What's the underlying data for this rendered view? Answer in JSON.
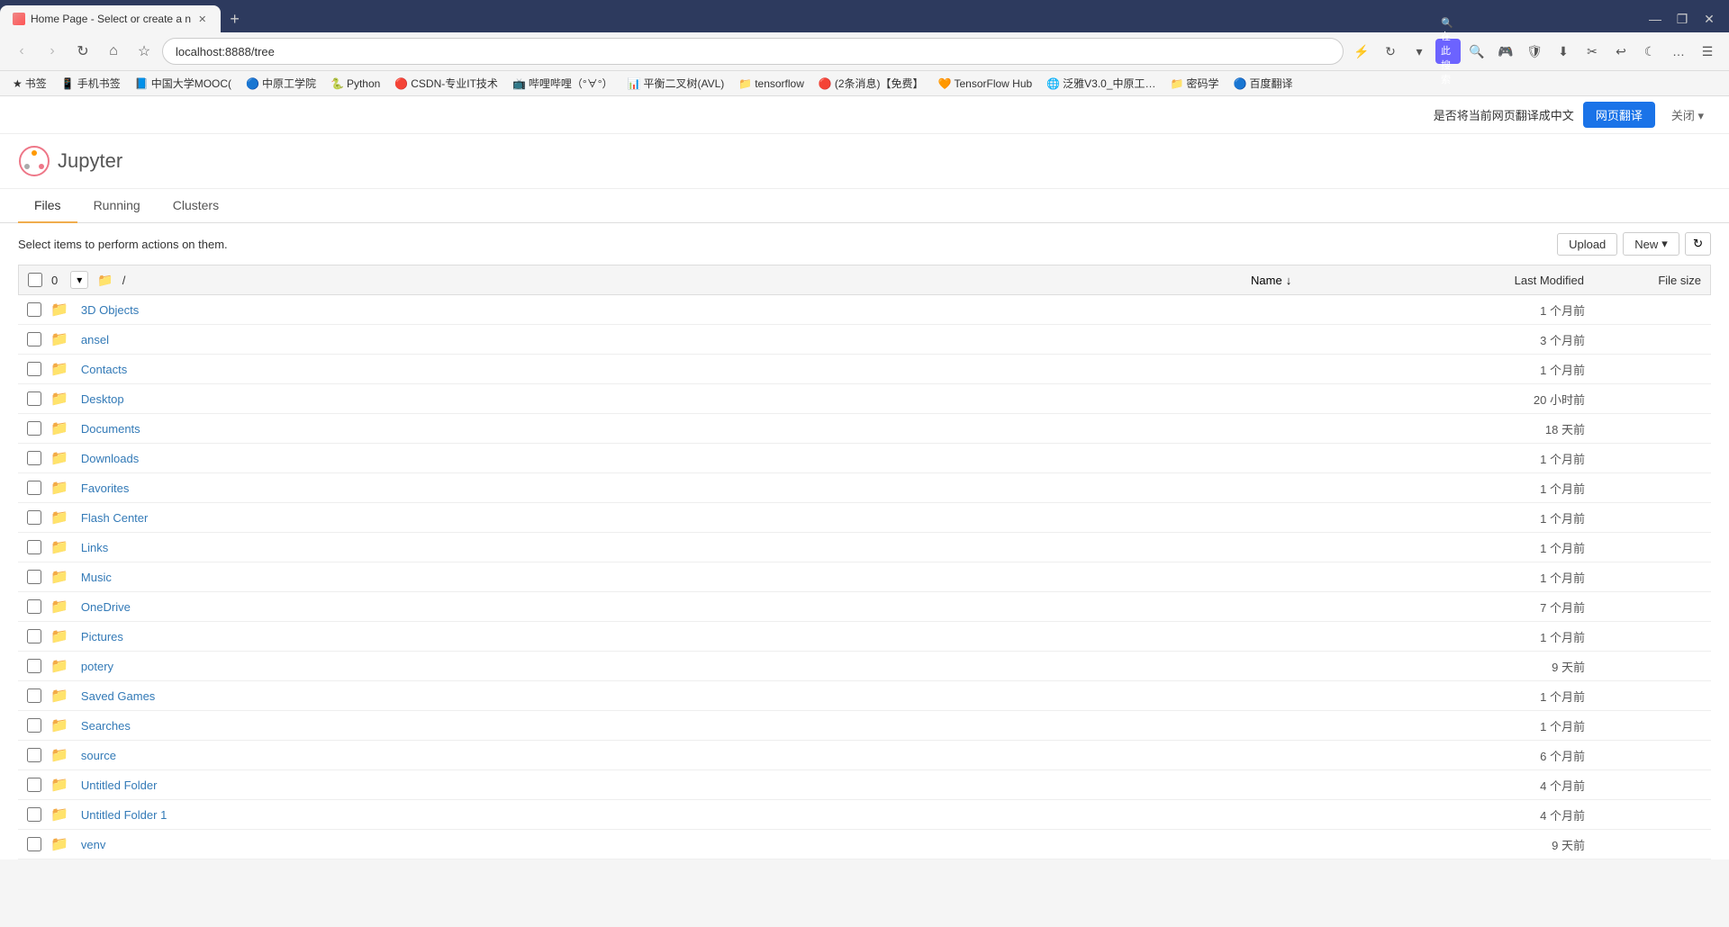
{
  "browser": {
    "tab_title": "Home Page - Select or create a n",
    "url": "localhost:8888/tree",
    "new_tab_icon": "+",
    "window_controls": [
      "—",
      "❐",
      "✕"
    ],
    "nav": {
      "back": "‹",
      "forward": "›",
      "reload": "↻",
      "home": "⌂",
      "bookmark": "☆",
      "search_placeholder": "在此搜索",
      "address": "localhost:8888/tree"
    },
    "bookmarks": [
      {
        "label": "书签",
        "icon": "★"
      },
      {
        "label": "手机书签",
        "icon": "📱"
      },
      {
        "label": "中国大学MOOC(",
        "icon": "📘"
      },
      {
        "label": "中原工学院",
        "icon": "🔵"
      },
      {
        "label": "Python",
        "icon": "🐍"
      },
      {
        "label": "CSDN-专业IT技术",
        "icon": "🔴"
      },
      {
        "label": "哔哩哔哩（°∀°）",
        "icon": "📺"
      },
      {
        "label": "平衡二叉树(AVL)",
        "icon": "📊"
      },
      {
        "label": "tensorflow",
        "icon": "📁"
      },
      {
        "label": "(2条消息)【免费】",
        "icon": "🔴"
      },
      {
        "label": "TensorFlow Hub",
        "icon": "🧡"
      },
      {
        "label": "泛雅V3.0_中原工…",
        "icon": "🌐"
      },
      {
        "label": "密码学",
        "icon": "📁"
      },
      {
        "label": "百度翻译",
        "icon": "🔵"
      }
    ]
  },
  "translation_bar": {
    "text": "是否将当前网页翻译成中文",
    "translate_btn": "网页翻译",
    "close_btn": "关闭",
    "arrow": "▾"
  },
  "jupyter": {
    "logo_text": "Jupyter",
    "tabs": [
      {
        "label": "Files",
        "active": true
      },
      {
        "label": "Running",
        "active": false
      },
      {
        "label": "Clusters",
        "active": false
      }
    ],
    "toolbar": {
      "select_text": "Select items to perform actions on them.",
      "upload_btn": "Upload",
      "new_btn": "New",
      "new_dropdown": "▾",
      "refresh_icon": "↻"
    },
    "file_header": {
      "count": "0",
      "sort_icon": "▾",
      "path_icon": "📁",
      "path": "/",
      "col_name": "Name",
      "col_name_sort": "↓",
      "col_last_modified": "Last Modified",
      "col_file_size": "File size"
    },
    "files": [
      {
        "name": "3D Objects",
        "modified": "1 个月前",
        "size": ""
      },
      {
        "name": "ansel",
        "modified": "3 个月前",
        "size": ""
      },
      {
        "name": "Contacts",
        "modified": "1 个月前",
        "size": ""
      },
      {
        "name": "Desktop",
        "modified": "20 小时前",
        "size": ""
      },
      {
        "name": "Documents",
        "modified": "18 天前",
        "size": ""
      },
      {
        "name": "Downloads",
        "modified": "1 个月前",
        "size": ""
      },
      {
        "name": "Favorites",
        "modified": "1 个月前",
        "size": ""
      },
      {
        "name": "Flash Center",
        "modified": "1 个月前",
        "size": ""
      },
      {
        "name": "Links",
        "modified": "1 个月前",
        "size": ""
      },
      {
        "name": "Music",
        "modified": "1 个月前",
        "size": ""
      },
      {
        "name": "OneDrive",
        "modified": "7 个月前",
        "size": ""
      },
      {
        "name": "Pictures",
        "modified": "1 个月前",
        "size": ""
      },
      {
        "name": "potery",
        "modified": "9 天前",
        "size": ""
      },
      {
        "name": "Saved Games",
        "modified": "1 个月前",
        "size": ""
      },
      {
        "name": "Searches",
        "modified": "1 个月前",
        "size": ""
      },
      {
        "name": "source",
        "modified": "6 个月前",
        "size": ""
      },
      {
        "name": "Untitled Folder",
        "modified": "4 个月前",
        "size": ""
      },
      {
        "name": "Untitled Folder 1",
        "modified": "4 个月前",
        "size": ""
      },
      {
        "name": "venv",
        "modified": "9 天前",
        "size": ""
      }
    ]
  }
}
